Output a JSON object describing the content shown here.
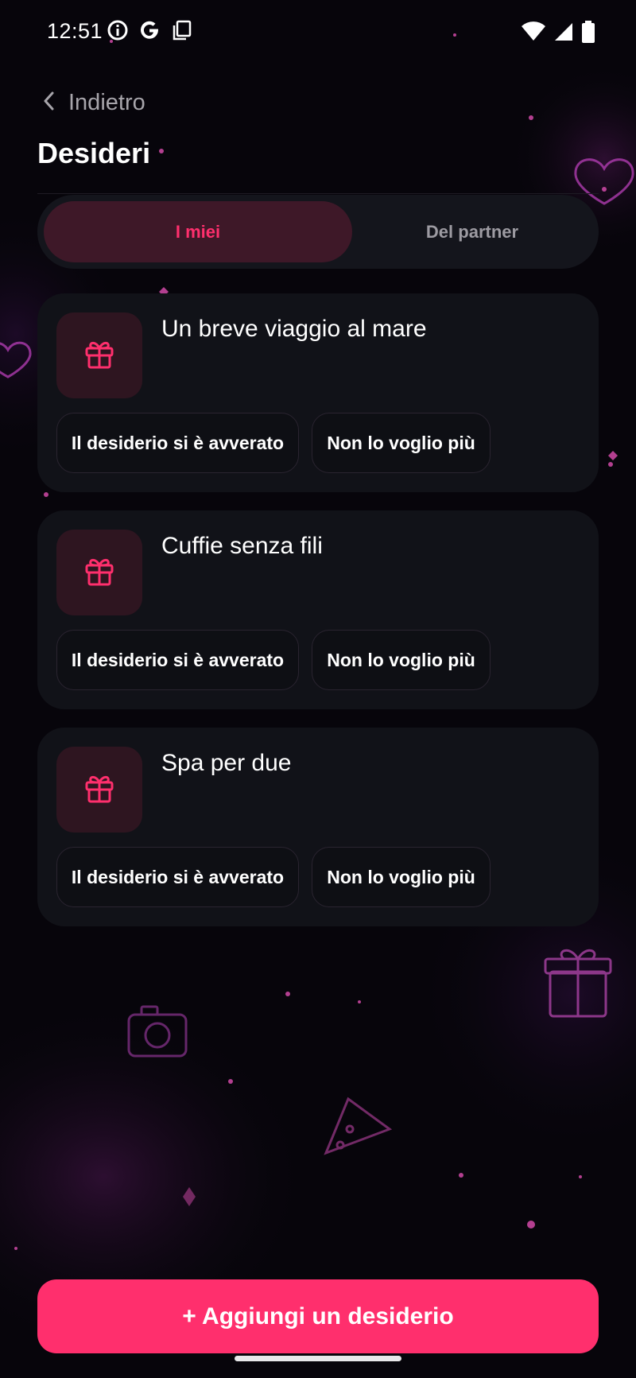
{
  "status_bar": {
    "time": "12:51",
    "left_icons": [
      "info-icon",
      "google-icon",
      "copy-icon"
    ],
    "right_icons": [
      "wifi-icon",
      "cellular-signal-icon",
      "battery-icon"
    ]
  },
  "header": {
    "back_label": "Indietro",
    "title": "Desideri"
  },
  "tabs": [
    {
      "label": "I miei",
      "active": true
    },
    {
      "label": "Del partner",
      "active": false
    }
  ],
  "wishes": [
    {
      "title": "Un breve viaggio al mare",
      "icon": "gift-icon",
      "fulfilled_label": "Il desiderio si è avverato",
      "remove_label": "Non lo voglio più"
    },
    {
      "title": "Cuffie senza fili",
      "icon": "gift-icon",
      "fulfilled_label": "Il desiderio si è avverato",
      "remove_label": "Non lo voglio più"
    },
    {
      "title": "Spa per due",
      "icon": "gift-icon",
      "fulfilled_label": "Il desiderio si è avverato",
      "remove_label": "Non lo voglio più"
    }
  ],
  "add_button_label": "+ Aggiungi un desiderio",
  "colors": {
    "accent": "#ff2f6d",
    "background": "#07050b",
    "card": "#111218",
    "tab_active_bg": "#3e1828",
    "icon_box": "#2e1520"
  }
}
